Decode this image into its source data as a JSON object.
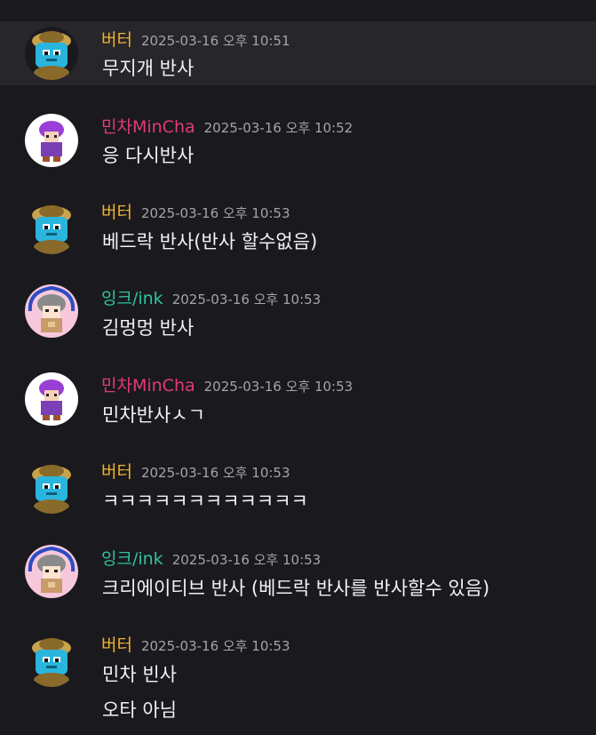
{
  "colors": {
    "background": "#1a1a1e",
    "highlight": "#26262b",
    "timestamp": "#a3a3ab",
    "text": "#f2f2f4"
  },
  "messages": [
    {
      "author": "버터",
      "author_color": "#f0b232",
      "avatar": "butter-avatar-icon",
      "time": "2025-03-16 오후 10:51",
      "lines": [
        "무지개 반사"
      ]
    },
    {
      "author": "민차MinCha",
      "author_color": "#e23a78",
      "avatar": "mincha-avatar-icon",
      "time": "2025-03-16 오후 10:52",
      "lines": [
        "응 다시반사"
      ]
    },
    {
      "author": "버터",
      "author_color": "#f0b232",
      "avatar": "butter-avatar-icon",
      "time": "2025-03-16 오후 10:53",
      "lines": [
        "베드락 반사(반사 할수없음)"
      ]
    },
    {
      "author": "잉크/ink",
      "author_color": "#2ec4a0",
      "avatar": "ink-avatar-icon",
      "time": "2025-03-16 오후 10:53",
      "lines": [
        "김멍멍 반사"
      ]
    },
    {
      "author": "민차MinCha",
      "author_color": "#e23a78",
      "avatar": "mincha-avatar-icon",
      "time": "2025-03-16 오후 10:53",
      "lines": [
        "민차반사ㅅㄱ"
      ]
    },
    {
      "author": "버터",
      "author_color": "#f0b232",
      "avatar": "butter-avatar-icon",
      "time": "2025-03-16 오후 10:53",
      "lines": [
        "ㅋㅋㅋㅋㅋㅋㅋㅋㅋㅋㅋㅋ"
      ]
    },
    {
      "author": "잉크/ink",
      "author_color": "#2ec4a0",
      "avatar": "ink-avatar-icon",
      "time": "2025-03-16 오후 10:53",
      "lines": [
        "크리에이티브 반사 (베드락 반사를 반사할수 있음)"
      ]
    },
    {
      "author": "버터",
      "author_color": "#f0b232",
      "avatar": "butter-avatar-icon",
      "time": "2025-03-16 오후 10:53",
      "lines": [
        "민차 빈사",
        "오타 아님"
      ]
    }
  ]
}
